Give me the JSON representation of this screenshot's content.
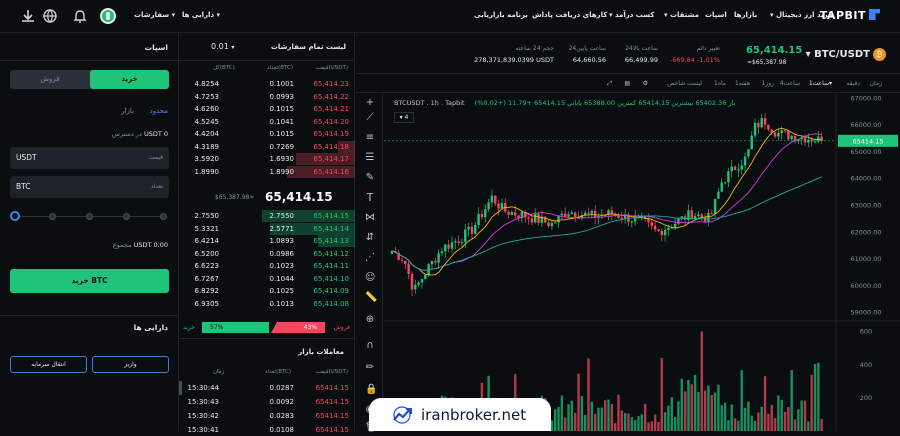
{
  "topbar": {
    "brand": "TAPBIT",
    "menu": [
      {
        "label": "خرید ارز دیجیتال",
        "chev": "▾"
      },
      {
        "label": "بازارها"
      },
      {
        "label": "اسپات"
      },
      {
        "label": "مشتقات",
        "chev": "▾"
      },
      {
        "label": "کسب درآمد",
        "chev": "▾"
      },
      {
        "label": "کارهای دریافت پاداش"
      },
      {
        "label": "برنامه بازاریابی"
      }
    ],
    "right_menu": [
      {
        "label": "دارایی ها",
        "chev": "▾"
      },
      {
        "label": "سفارشات",
        "chev": "▾"
      }
    ]
  },
  "market": {
    "pair": "BTC/USDT",
    "pair_chev": "▾",
    "last_price": "65,414.15",
    "last_price_fiat": "≈$65,387.98",
    "stats": [
      {
        "key": "تغییر دائم",
        "value": "-669.84  -1.01%",
        "color": "#f6465d"
      },
      {
        "key": "24ساعت بالا",
        "value": "66,499.99"
      },
      {
        "key": "24ساعت پایین",
        "value": "64,660.56"
      },
      {
        "key": "حجم 24 ساعته",
        "value": "278,371,839.0399 USDT"
      }
    ]
  },
  "left": {
    "title": "اسپات",
    "buy": "خرید",
    "sell": "فروش",
    "order_types": [
      "محدود",
      "بازار"
    ],
    "available": "USDT 0",
    "available_label": "در دسترس",
    "price_value": "USDT",
    "price_label": "قیمت",
    "amount_value": "BTC",
    "amount_label": "تعداد",
    "total": "USDT 0.00",
    "total_label": "مجموع",
    "buy_button": "خرید BTC",
    "assets_title": "دارایی ها",
    "deposit": "واریز",
    "transfer": "انتقال سرمایه",
    "slider_percent": 0
  },
  "orderbook": {
    "title": "لیست تمام سفارشات",
    "precision": "0.01",
    "col_price": "قیمت(USDT)",
    "col_amount": "تعداد(BTC)",
    "col_total": "کل(BTC)",
    "asks": [
      {
        "price": "65,414.23",
        "amount": "0.1001",
        "total": "4.8254",
        "depth": 0
      },
      {
        "price": "65,414.22",
        "amount": "0.0993",
        "total": "4.7253",
        "depth": 0
      },
      {
        "price": "65,414.21",
        "amount": "0.1015",
        "total": "4.6260",
        "depth": 0
      },
      {
        "price": "65,414.20",
        "amount": "0.1041",
        "total": "4.5245",
        "depth": 0
      },
      {
        "price": "65,414.19",
        "amount": "0.1015",
        "total": "4.4204",
        "depth": 0
      },
      {
        "price": "65,414.18",
        "amount": "0.7269",
        "total": "4.3189",
        "depth": 0.1
      },
      {
        "price": "65,414.17",
        "amount": "1.6930",
        "total": "3.5920",
        "depth": 0.35
      },
      {
        "price": "65,414.16",
        "amount": "1.8990",
        "total": "1.8990",
        "depth": 0.4
      }
    ],
    "mid_price": "65,414.15",
    "mid_fiat": "$65,387.98≈",
    "bids": [
      {
        "price": "65,414.15",
        "amount": "2.7550",
        "total": "2.7550",
        "depth": 0.55
      },
      {
        "price": "65,414.14",
        "amount": "2.5771",
        "total": "5.3321",
        "depth": 0.5
      },
      {
        "price": "65,414.13",
        "amount": "1.0893",
        "total": "6.4214",
        "depth": 0.22
      },
      {
        "price": "65,414.12",
        "amount": "0.0986",
        "total": "6.5200",
        "depth": 0
      },
      {
        "price": "65,414.11",
        "amount": "0.1023",
        "total": "6.6223",
        "depth": 0
      },
      {
        "price": "65,414.10",
        "amount": "0.1044",
        "total": "6.7267",
        "depth": 0
      },
      {
        "price": "65,414.09",
        "amount": "0.1025",
        "total": "6.8292",
        "depth": 0
      },
      {
        "price": "65,414.08",
        "amount": "0.1013",
        "total": "6.9305",
        "depth": 0
      }
    ],
    "buy_ratio": "57%",
    "sell_ratio": "43%",
    "buy_ratio_label": "خرید",
    "sell_ratio_label": "فروش",
    "buy_ratio_value": 57
  },
  "trades": {
    "title": "معاملات بازار",
    "col_price": "قیمت(USDT)",
    "col_amount": "تعداد(BTC)",
    "col_time": "زمان",
    "rows": [
      {
        "price": "65414.15",
        "amount": "0.0287",
        "time": "15:30:44"
      },
      {
        "price": "65414.15",
        "amount": "0.0092",
        "time": "15:30:43"
      },
      {
        "price": "65414.15",
        "amount": "0.0283",
        "time": "15:30:42"
      },
      {
        "price": "65414.15",
        "amount": "0.0108",
        "time": "15:30:41"
      }
    ]
  },
  "chart_toolbar": {
    "items": [
      "زمان",
      "دقیقه",
      "1ساعت▾",
      "4ساعت",
      "1روز",
      "1هفته",
      "1ماه",
      "لیست شاخص"
    ],
    "active": "1ساعت▾"
  },
  "chart_data": {
    "type": "candlestick",
    "legend": "BTCUSDT . 1h . Tapbit",
    "ohlc_text": "باز 65402.36  بیشترین 65414.15  کمترین 65388.00  پایانی 65414.15  +11.79 (+0.02%)",
    "indicator_count": "4",
    "y_ticks": [
      "67000.00",
      "66000.00",
      "65000.00",
      "64000.00",
      "63000.00",
      "62000.00",
      "61000.00",
      "60000.00",
      "59000.00"
    ],
    "ylim": [
      58800,
      67200
    ],
    "price_tag": "65414.15",
    "volume_ticks": [
      "600",
      "400",
      "200"
    ],
    "volume_ylim": [
      0,
      640
    ]
  },
  "watermark": "iranbroker.net"
}
